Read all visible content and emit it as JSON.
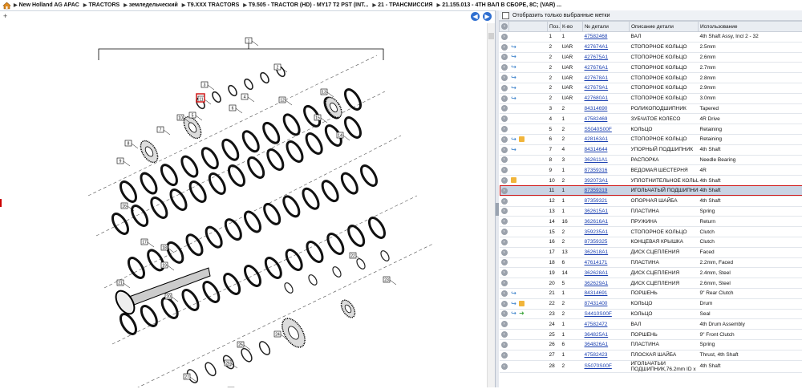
{
  "breadcrumb": [
    "New Holland AG APAC",
    "TRACTORS",
    "земледельческий",
    "T9.XXX TRACTORS",
    "T9.505 - TRACTOR (HD) - MY17 T2 PST (INT...",
    "21 - ТРАНСМИССИЯ",
    "21.155.013 - 4TH ВАЛ В СБОРЕ, 8С; (VAR) ..."
  ],
  "filter_label": "Отобразить только выбранные метки",
  "columns": [
    "Поз.",
    "К-во",
    "№ детали",
    "Описание детали",
    "Использование"
  ],
  "diagram": {
    "labels": [
      "1",
      "2",
      "3",
      "4",
      "5",
      "6",
      "7",
      "8",
      "9",
      "10",
      "11",
      "12",
      "13",
      "14",
      "15",
      "16",
      "17",
      "18",
      "19",
      "20",
      "21",
      "22",
      "23",
      "24",
      "25",
      "26",
      "27",
      "28"
    ]
  },
  "rows": [
    {
      "pos": "1",
      "qty": "1",
      "part": "47582468",
      "desc": "ВАЛ",
      "use": "4th Shaft Assy, Incl 2 - 32",
      "icons": []
    },
    {
      "pos": "2",
      "qty": "UAR",
      "part": "427674A1",
      "desc": "СТОПОРНОЕ КОЛЬЦО",
      "use": "2.5mm",
      "icons": [
        "link"
      ]
    },
    {
      "pos": "2",
      "qty": "UAR",
      "part": "427675A1",
      "desc": "СТОПОРНОЕ КОЛЬЦО",
      "use": "2.6mm",
      "icons": [
        "link"
      ]
    },
    {
      "pos": "2",
      "qty": "UAR",
      "part": "427676A1",
      "desc": "СТОПОРНОЕ КОЛЬЦО",
      "use": "2.7mm",
      "icons": [
        "link"
      ]
    },
    {
      "pos": "2",
      "qty": "UAR",
      "part": "427678A1",
      "desc": "СТОПОРНОЕ КОЛЬЦО",
      "use": "2.8mm",
      "icons": [
        "link"
      ]
    },
    {
      "pos": "2",
      "qty": "UAR",
      "part": "427679A1",
      "desc": "СТОПОРНОЕ КОЛЬЦО",
      "use": "2.9mm",
      "icons": [
        "link"
      ]
    },
    {
      "pos": "2",
      "qty": "UAR",
      "part": "427680A1",
      "desc": "СТОПОРНОЕ КОЛЬЦО",
      "use": "3.0mm",
      "icons": [
        "link"
      ]
    },
    {
      "pos": "3",
      "qty": "2",
      "part": "84314690",
      "desc": "РОЛИКОПОДШИПНИК",
      "use": "Tapered",
      "icons": []
    },
    {
      "pos": "4",
      "qty": "1",
      "part": "47582469",
      "desc": "ЗУБЧАТОЕ КОЛЕСО",
      "use": "4R Drive",
      "icons": []
    },
    {
      "pos": "5",
      "qty": "2",
      "part": "S5040S00F",
      "desc": "КОЛЬЦО",
      "use": "Retaining",
      "icons": []
    },
    {
      "pos": "6",
      "qty": "2",
      "part": "428163A1",
      "desc": "СТОПОРНОЕ КОЛЬЦО",
      "use": "Retaining",
      "icons": [
        "link",
        "cube"
      ]
    },
    {
      "pos": "7",
      "qty": "4",
      "part": "84314644",
      "desc": "УПОРНЫЙ ПОДШИПНИК",
      "use": "4th Shaft",
      "icons": [
        "link"
      ]
    },
    {
      "pos": "8",
      "qty": "3",
      "part": "362611A1",
      "desc": "РАСПОРКА",
      "use": "Needle Bearing",
      "icons": []
    },
    {
      "pos": "9",
      "qty": "1",
      "part": "87359316",
      "desc": "ВЕДОМАЯ ШЕСТЕРНЯ",
      "use": "4R",
      "icons": []
    },
    {
      "pos": "10",
      "qty": "2",
      "part": "392073A1",
      "desc": "УПЛОТНИТЕЛЬНОЕ КОЛЬЦ",
      "use": "4th Shaft",
      "icons": [
        "cube"
      ]
    },
    {
      "pos": "11",
      "qty": "1",
      "part": "87359319",
      "desc": "ИГОЛЬЧАТЫЙ ПОДШИПНИК",
      "use": "4th Shaft",
      "icons": [],
      "selected": true
    },
    {
      "pos": "12",
      "qty": "1",
      "part": "87359321",
      "desc": "ОПОРНАЯ ШАЙБА",
      "use": "4th Shaft",
      "icons": []
    },
    {
      "pos": "13",
      "qty": "1",
      "part": "362615A1",
      "desc": "ПЛАСТИНА",
      "use": "Spring",
      "icons": []
    },
    {
      "pos": "14",
      "qty": "16",
      "part": "362616A1",
      "desc": "ПРУЖИНА",
      "use": "Return",
      "icons": []
    },
    {
      "pos": "15",
      "qty": "2",
      "part": "359235A1",
      "desc": "СТОПОРНОЕ КОЛЬЦО",
      "use": "Clutch",
      "icons": []
    },
    {
      "pos": "16",
      "qty": "2",
      "part": "87359325",
      "desc": "КОНЦЕВАЯ КРЫШКА",
      "use": "Clutch",
      "icons": []
    },
    {
      "pos": "17",
      "qty": "13",
      "part": "362618A1",
      "desc": "ДИСК СЦЕПЛЕНИЯ",
      "use": "Faced",
      "icons": []
    },
    {
      "pos": "18",
      "qty": "6",
      "part": "47614171",
      "desc": "ПЛАСТИНА",
      "use": "2.2mm, Faced",
      "icons": []
    },
    {
      "pos": "19",
      "qty": "14",
      "part": "362628A1",
      "desc": "ДИСК СЦЕПЛЕНИЯ",
      "use": "2.4mm, Steel",
      "icons": []
    },
    {
      "pos": "20",
      "qty": "5",
      "part": "362629A1",
      "desc": "ДИСК СЦЕПЛЕНИЯ",
      "use": "2.6mm, Steel",
      "icons": []
    },
    {
      "pos": "21",
      "qty": "1",
      "part": "84314691",
      "desc": "ПОРШЕНЬ",
      "use": "9\" Rear Clutch",
      "icons": [
        "link"
      ]
    },
    {
      "pos": "22",
      "qty": "2",
      "part": "87431400",
      "desc": "КОЛЬЦО",
      "use": "Drum",
      "icons": [
        "link",
        "cube"
      ]
    },
    {
      "pos": "23",
      "qty": "2",
      "part": "S4410S00F",
      "desc": "КОЛЬЦО",
      "use": "Seal",
      "icons": [
        "link",
        "green"
      ]
    },
    {
      "pos": "24",
      "qty": "1",
      "part": "47582472",
      "desc": "ВАЛ",
      "use": "4th Drum Assembly",
      "icons": []
    },
    {
      "pos": "25",
      "qty": "1",
      "part": "364825A1",
      "desc": "ПОРШЕНЬ",
      "use": "9\" Front Clutch",
      "icons": []
    },
    {
      "pos": "26",
      "qty": "6",
      "part": "364826A1",
      "desc": "ПЛАСТИНА",
      "use": "Spring",
      "icons": []
    },
    {
      "pos": "27",
      "qty": "1",
      "part": "47582423",
      "desc": "ПЛОСКАЯ ШАЙБА",
      "use": "Thrust, 4th Shaft",
      "icons": []
    },
    {
      "pos": "28",
      "qty": "2",
      "part": "S5070S00F",
      "desc": "ИГОЛЬЧАТЫЙ ПОДШИПНИК,76.2mm ID x",
      "use": "4th Shaft",
      "icons": [],
      "multi": true
    }
  ]
}
